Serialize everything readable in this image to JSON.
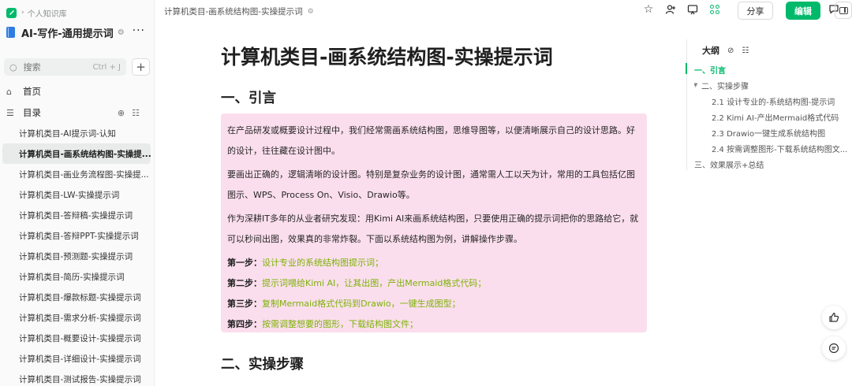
{
  "sidebar": {
    "crumb": "个人知识库",
    "kb_title": "AI-写作-通用提示词",
    "search": {
      "placeholder": "搜索",
      "shortcut": "Ctrl + J"
    },
    "home_label": "首页",
    "toc_label": "目录",
    "docs": [
      "计算机类目-AI提示词-认知",
      "计算机类目-画系统结构图-实操提...",
      "计算机类目-画业务流程图-实操提...",
      "计算机类目-LW-实操提示词",
      "计算机类目-答辩稿-实操提示词",
      "计算机类目-答辩PPT-实操提示词",
      "计算机类目-预测题-实操提示词",
      "计算机类目-简历-实操提示词",
      "计算机类目-爆款标题-实操提示词",
      "计算机类目-需求分析-实操提示词",
      "计算机类目-概要设计-实操提示词",
      "计算机类目-详细设计-实操提示词",
      "计算机类目-测试报告-实操提示词"
    ],
    "active_index": 1
  },
  "header": {
    "doc_crumb": "计算机类目-画系统结构图-实操提示词",
    "share_label": "分享",
    "edit_label": "编辑"
  },
  "doc": {
    "title": "计算机类目-画系统结构图-实操提示词",
    "section1": "一、引言",
    "para1": "在产品研发或概要设计过程中，我们经常需画系统结构图，思维导图等，以便清晰展示自己的设计思路。好的设计，往往藏在设计图中。",
    "para2": "要画出正确的，逻辑清晰的设计图。特别是复杂业务的设计图，通常需人工以天为计，常用的工具包括亿图图示、WPS、Process On、Visio、Drawio等。",
    "para3": "作为深耕IT多年的从业者研究发现：用Kimi AI来画系统结构图，只要使用正确的提示词把你的思路给它，就可以秒间出图，效果真的非常炸裂。下面以系统结构图为例，讲解操作步骤。",
    "steps": [
      {
        "label": "第一步：",
        "text": "设计专业的系统结构图提示词；"
      },
      {
        "label": "第二步：",
        "text": "提示词喂给Kimi AI，让其出图，产出Mermaid格式代码；"
      },
      {
        "label": "第三步：",
        "text": "复制Mermaid格式代码到Drawio，一键生成图型；"
      },
      {
        "label": "第四步：",
        "text": "按需调整想要的图形，下载结构图文件；"
      }
    ],
    "section2": "二、实操步骤"
  },
  "outline": {
    "title": "大纲",
    "items": [
      "一、引言",
      "二、实操步骤",
      "2.1 设计专业的-系统结构图-提示词",
      "2.2 Kimi AI-产出Mermaid格式代码",
      "2.3 Drawio一键生成系统结构图",
      "2.4 按需调整图形-下载系统结构图文...",
      "三、效果展示+总结"
    ]
  },
  "colors": {
    "accent": "#00b96b",
    "callout_bg": "#fbdeed",
    "step_text": "#7cb305"
  }
}
